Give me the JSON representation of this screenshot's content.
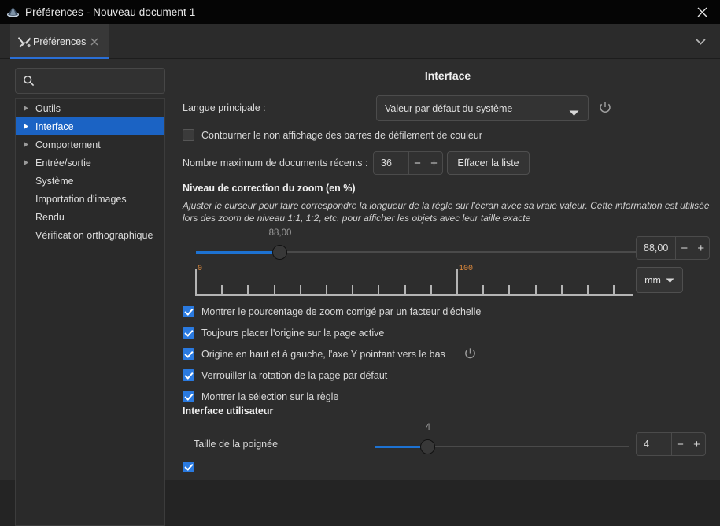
{
  "window": {
    "title": "Préférences - Nouveau document 1",
    "logo_icon": "inkscape-logo-icon",
    "close_icon": "close-icon"
  },
  "tabstrip": {
    "tab_label": "Préférences",
    "tab_icon": "preferences-tools-icon",
    "tab_close_icon": "close-icon",
    "overflow_icon": "chevron-down-icon"
  },
  "sidebar": {
    "search_placeholder": "",
    "search_value": "",
    "search_icon": "search-icon",
    "items": [
      {
        "label": "Outils",
        "expandable": true,
        "selected": false
      },
      {
        "label": "Interface",
        "expandable": true,
        "selected": true
      },
      {
        "label": "Comportement",
        "expandable": true,
        "selected": false
      },
      {
        "label": "Entrée/sortie",
        "expandable": true,
        "selected": false
      },
      {
        "label": "Système",
        "expandable": false,
        "selected": false
      },
      {
        "label": "Importation d'images",
        "expandable": false,
        "selected": false
      },
      {
        "label": "Rendu",
        "expandable": false,
        "selected": false
      },
      {
        "label": "Vérification orthographique",
        "expandable": false,
        "selected": false
      }
    ]
  },
  "main": {
    "title": "Interface",
    "language": {
      "label": "Langue principale :",
      "value": "Valeur par défaut du système",
      "dropdown_icon": "chevron-down-icon",
      "reset_icon": "power-reset-icon"
    },
    "scrollbar_checkbox": {
      "label": "Contourner le non affichage des barres de défilement de couleur",
      "checked": false
    },
    "recent_docs": {
      "label": "Nombre maximum de documents récents :",
      "value": "36",
      "minus": "−",
      "plus": "+",
      "clear_button": "Effacer la liste"
    },
    "zoom_section": {
      "heading": "Niveau de correction du zoom (en %)",
      "description_line1": "Ajuster le curseur pour faire correspondre la longueur de la règle sur l'écran avec sa vraie valeur. Cette information est utilisée",
      "description_line2": "lors des zoom de niveau 1:1, 1:2, etc. pour afficher les objets avec leur taille exacte",
      "slider_value": "88,00",
      "slider_percent": 19,
      "spin_value": "88,00",
      "minus": "−",
      "plus": "+",
      "unit": "mm",
      "unit_dropdown_icon": "chevron-down-icon",
      "ruler_labels": [
        "0",
        "100"
      ]
    },
    "checkboxes": [
      {
        "label": "Montrer le pourcentage de zoom corrigé par un facteur d'échelle",
        "checked": true,
        "reset_icon": null
      },
      {
        "label": "Toujours placer l'origine sur la page active",
        "checked": true,
        "reset_icon": null
      },
      {
        "label": "Origine en haut et à gauche, l'axe Y pointant vers le bas",
        "checked": true,
        "reset_icon": "power-reset-icon"
      },
      {
        "label": "Verrouiller la rotation de la page par défaut",
        "checked": true,
        "reset_icon": null
      },
      {
        "label": "Montrer la sélection sur la règle",
        "checked": true,
        "reset_icon": null
      }
    ],
    "ui_section": {
      "heading": "Interface utilisateur",
      "handle_label": "Taille de la poignée",
      "handle_slider_value": "4",
      "handle_slider_percent": 21,
      "handle_spin_value": "4",
      "minus": "−",
      "plus": "+"
    }
  },
  "colors": {
    "accent": "#1b63c4",
    "slider_blue": "#1d72d2",
    "checkbox_blue": "#2a7ae0",
    "background": "#2d2d2d",
    "titlebar": "#050505",
    "ruler_label": "#e08a3c"
  }
}
